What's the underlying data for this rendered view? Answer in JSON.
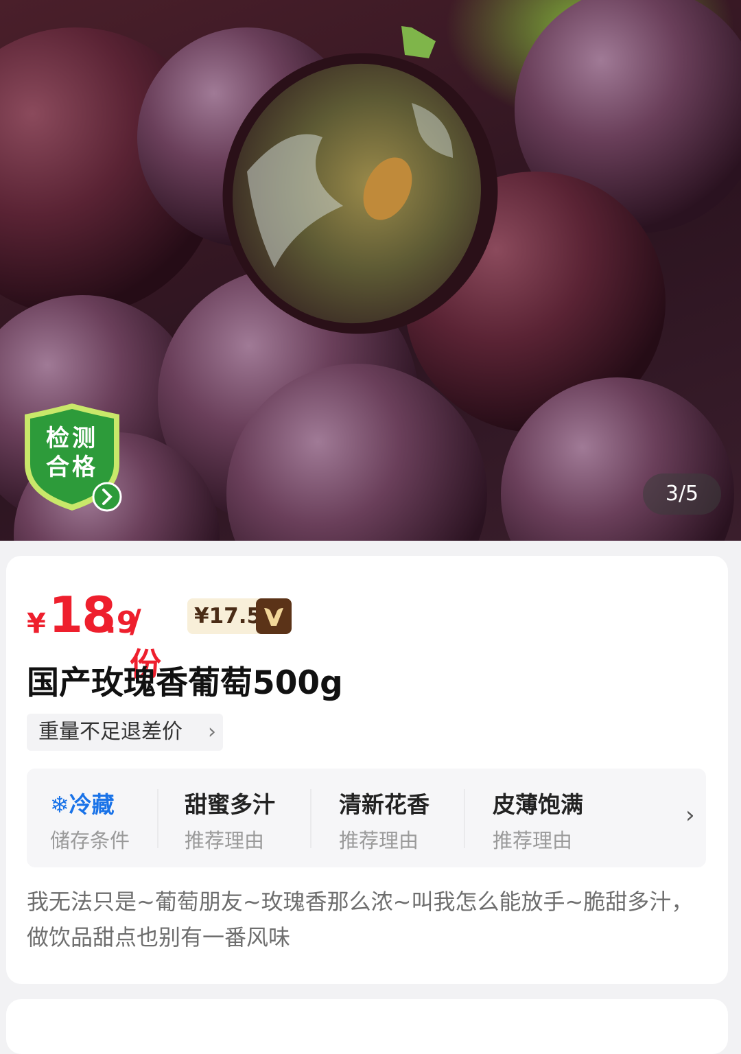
{
  "hero": {
    "image_label": "grapes-photo",
    "badge": {
      "line1": "检测",
      "line2": "合格"
    },
    "counter": "3/5"
  },
  "product": {
    "price": {
      "currency": "¥",
      "integer": "18",
      "decimal": ".9",
      "unit": "/份"
    },
    "vip_price": "¥17.5",
    "vip_icon": "V",
    "title": "国产玫瑰香葡萄500g",
    "refund": {
      "label": "重量不足退差价",
      "chevron": "›"
    },
    "attributes": [
      {
        "value": "冷藏",
        "key": "储存条件",
        "icon": "snowflake-icon"
      },
      {
        "value": "甜蜜多汁",
        "key": "推荐理由"
      },
      {
        "value": "清新花香",
        "key": "推荐理由"
      },
      {
        "value": "皮薄饱满",
        "key": "推荐理由"
      }
    ],
    "attributes_more": "›",
    "description": "我无法只是~葡萄朋友~玫瑰香那么浓~叫我怎么能放手~脆甜多汁，做饮品甜点也别有一番风味"
  },
  "colors": {
    "price_red": "#ee1f2d",
    "cold_blue": "#1a73e8",
    "badge_green": "#2d9b3a",
    "vip_brown": "#5b3318"
  }
}
